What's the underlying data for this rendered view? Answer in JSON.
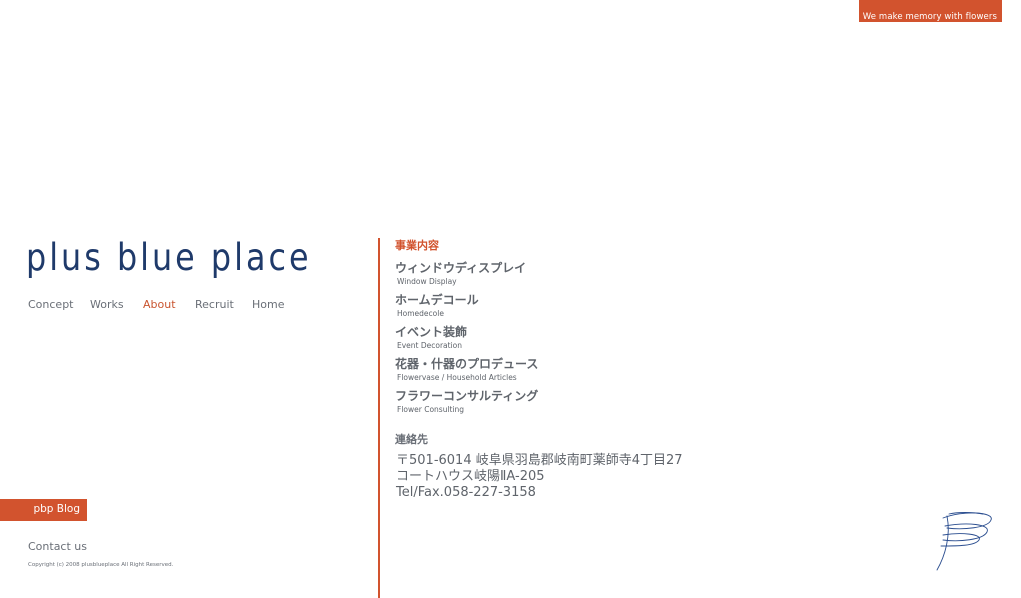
{
  "header": {
    "tagline": "We make memory with flowers"
  },
  "logo": {
    "text": "plus blue place"
  },
  "nav": [
    {
      "label": "Concept",
      "active": false
    },
    {
      "label": "Works",
      "active": false
    },
    {
      "label": "About",
      "active": true
    },
    {
      "label": "Recruit",
      "active": false
    },
    {
      "label": "Home",
      "active": false
    }
  ],
  "sidebar": {
    "blog_label": "pbp Blog",
    "contact_label": "Contact us",
    "copyright": "Copyright (c)  2008  plusblueplace  All Right Reserved."
  },
  "about": {
    "business_title": "事業内容",
    "services": [
      {
        "jp": "ウィンドウディスプレイ",
        "en": "Window Display"
      },
      {
        "jp": "ホームデコール",
        "en": "Homedecole"
      },
      {
        "jp": "イベント装飾",
        "en": "Event Decoration"
      },
      {
        "jp": "花器・什器のプロデュース",
        "en": "Flowervase / Household Articles"
      },
      {
        "jp": "フラワーコンサルティング",
        "en": "Flower Consulting"
      }
    ],
    "contact_title": "連絡先",
    "address_lines": [
      "〒501-6014 岐阜県羽島郡岐南町薬師寺4丁目27",
      "コートハウス岐陽ⅡA-205",
      "Tel/Fax.058-227-3158"
    ]
  },
  "colors": {
    "accent": "#d2532e",
    "logo": "#1f3a6a",
    "text": "#5f646b"
  },
  "icons": {
    "signature": "pbp-signature-mark-icon"
  }
}
